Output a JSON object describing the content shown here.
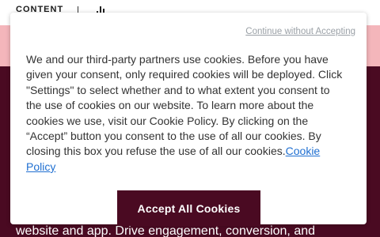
{
  "background": {
    "logo_text": "CONTENT",
    "footer_text": "website and app. Drive engagement, conversion, and",
    "colors": {
      "pink_band": "#f4b6bb",
      "maroon": "#4a0a22"
    },
    "bars_icon": "bar-chart-icon"
  },
  "cookie_dialog": {
    "continue_link": "Continue without Accepting",
    "body_text": "We and our third-party partners use cookies. Before you have given your consent, only required cookies will be deployed. Click \"Settings\" to select whether and to what extent you consent to the use of cookies on our website. To learn more about the cookies we use, visit our Cookie Policy. By clicking on the “Accept” button you consent to the use of all our cookies. By closing this box you refuse the use of all our cookies.",
    "policy_link": "Cookie Policy",
    "accept_button": "Accept All Cookies",
    "colors": {
      "accent": "#4a0a22",
      "link": "#1f6fd1",
      "muted_link": "#9aa0a6"
    }
  }
}
